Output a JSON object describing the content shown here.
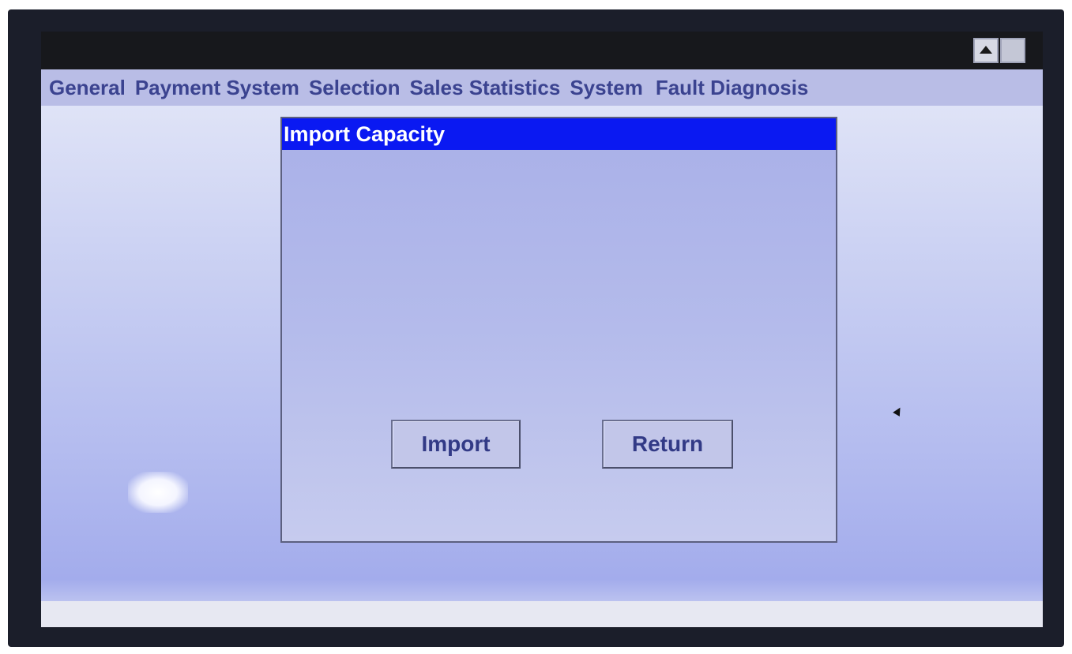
{
  "menu": {
    "items": [
      {
        "label": "General"
      },
      {
        "label": "Payment System"
      },
      {
        "label": "Selection"
      },
      {
        "label": "Sales Statistics"
      },
      {
        "label": "System"
      },
      {
        "label": "Fault Diagnosis"
      }
    ]
  },
  "window_controls": {
    "up_icon": "triangle-up-icon",
    "square_icon": "square-icon"
  },
  "dialog": {
    "title": "Import Capacity",
    "import_label": "Import",
    "return_label": "Return"
  },
  "colors": {
    "dialog_title_bg": "#0a19f2",
    "menu_text": "#3b4390",
    "titlebar_bg": "#17181c"
  }
}
